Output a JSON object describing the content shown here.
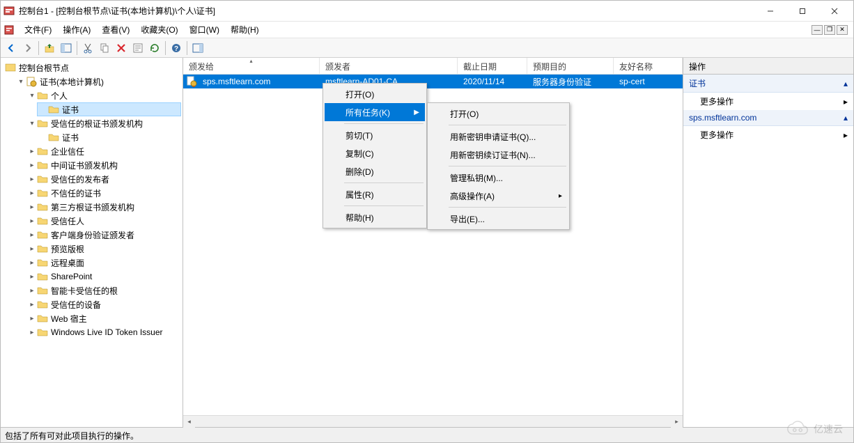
{
  "title": "控制台1 - [控制台根节点\\证书(本地计算机)\\个人\\证书]",
  "menubar": [
    "文件(F)",
    "操作(A)",
    "查看(V)",
    "收藏夹(O)",
    "窗口(W)",
    "帮助(H)"
  ],
  "tree": {
    "root": "控制台根节点",
    "certs_root": "证书(本地计算机)",
    "personal": "个人",
    "personal_certs": "证书",
    "trusted_root_ca": "受信任的根证书颁发机构",
    "trusted_root_ca_certs": "证书",
    "items": [
      "企业信任",
      "中间证书颁发机构",
      "受信任的发布者",
      "不信任的证书",
      "第三方根证书颁发机构",
      "受信任人",
      "客户端身份验证颁发者",
      "预览版根",
      "远程桌面",
      "SharePoint",
      "智能卡受信任的根",
      "受信任的设备",
      "Web 宿主",
      "Windows Live ID Token Issuer"
    ]
  },
  "columns": {
    "issued_to": "颁发给",
    "issued_by": "颁发者",
    "expires": "截止日期",
    "purpose": "预期目的",
    "friendly": "友好名称"
  },
  "col_widths": {
    "issued_to": 196,
    "issued_by": 198,
    "expires": 100,
    "purpose": 124,
    "friendly": 90
  },
  "rows": [
    {
      "issued_to": "sps.msftlearn.com",
      "issued_by": "msftlearn-AD01-CA",
      "expires": "2020/11/14",
      "purpose": "服务器身份验证",
      "friendly": "sp-cert"
    }
  ],
  "ctx1": {
    "open": "打开(O)",
    "all_tasks": "所有任务(K)",
    "cut": "剪切(T)",
    "copy": "复制(C)",
    "delete": "删除(D)",
    "properties": "属性(R)",
    "help": "帮助(H)"
  },
  "ctx2": {
    "open": "打开(O)",
    "req_new_key": "用新密钥申请证书(Q)...",
    "renew_new_key": "用新密钥续订证书(N)...",
    "manage_pk": "管理私钥(M)...",
    "advanced": "高级操作(A)",
    "export": "导出(E)..."
  },
  "actions": {
    "header": "操作",
    "sec1": "证书",
    "sec2": "sps.msftlearn.com",
    "more": "更多操作"
  },
  "status": "包括了所有可对此项目执行的操作。",
  "watermark": "亿速云"
}
